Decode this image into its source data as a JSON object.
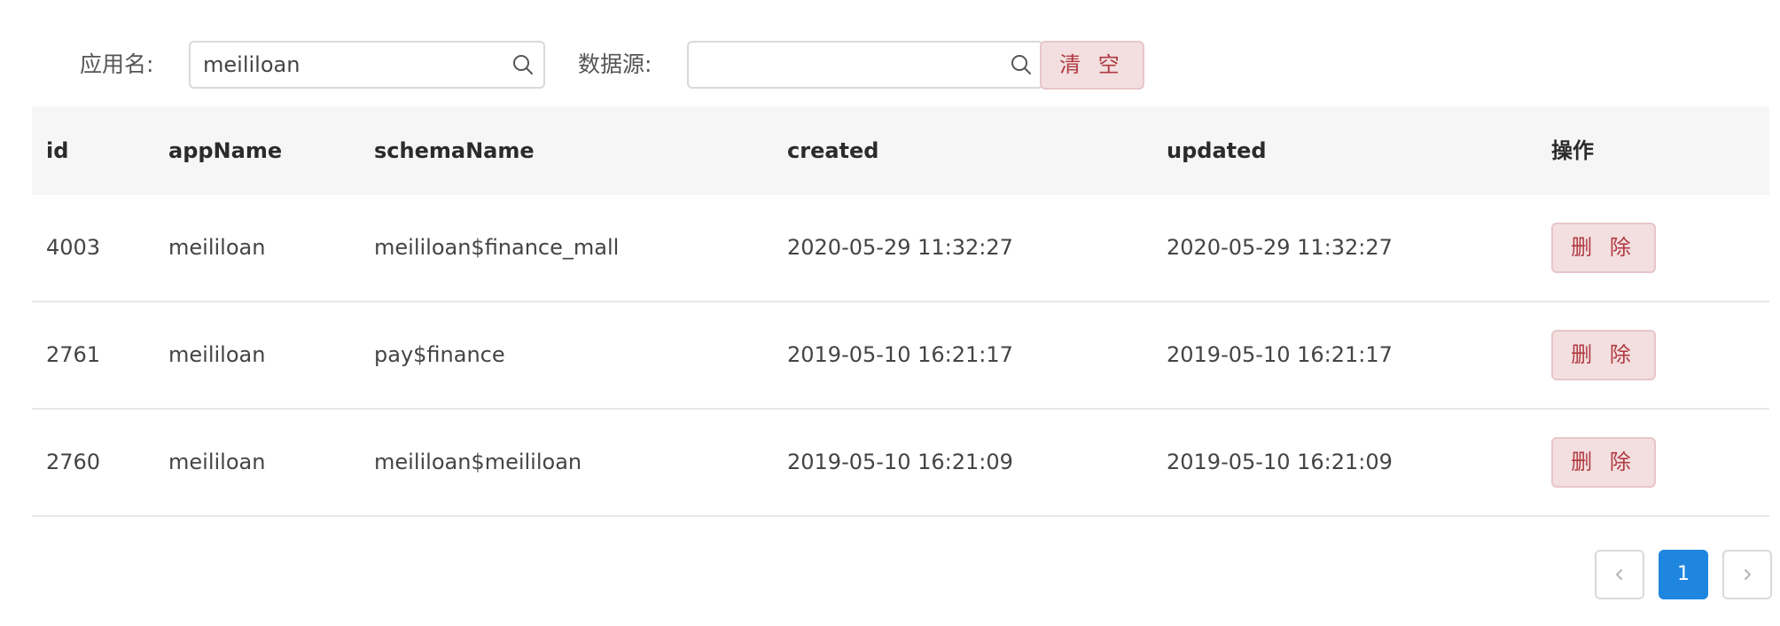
{
  "filters": {
    "app_label": "应用名:",
    "app_value": "meililoan",
    "app_placeholder": "",
    "schema_label": "数据源:",
    "schema_value": "",
    "schema_placeholder": "",
    "clear_label": "清 空",
    "search_icon": "search-icon"
  },
  "table": {
    "headers": {
      "id": "id",
      "appName": "appName",
      "schemaName": "schemaName",
      "created": "created",
      "updated": "updated",
      "action": "操作"
    },
    "rows": [
      {
        "id": "4003",
        "appName": "meililoan",
        "schemaName": "meililoan$finance_mall",
        "created": "2020-05-29 11:32:27",
        "updated": "2020-05-29 11:32:27",
        "delete_label": "删 除"
      },
      {
        "id": "2761",
        "appName": "meililoan",
        "schemaName": "pay$finance",
        "created": "2019-05-10 16:21:17",
        "updated": "2019-05-10 16:21:17",
        "delete_label": "删 除"
      },
      {
        "id": "2760",
        "appName": "meililoan",
        "schemaName": "meililoan$meililoan",
        "created": "2019-05-10 16:21:09",
        "updated": "2019-05-10 16:21:09",
        "delete_label": "删 除"
      }
    ]
  },
  "pagination": {
    "prev_icon": "chevron-left-icon",
    "current_page": "1",
    "next_icon": "chevron-right-icon"
  },
  "colors": {
    "danger_text": "#b03a41",
    "danger_bg": "#f3dfe0",
    "primary": "#1f86e0",
    "header_bg": "#f6f6f6"
  }
}
